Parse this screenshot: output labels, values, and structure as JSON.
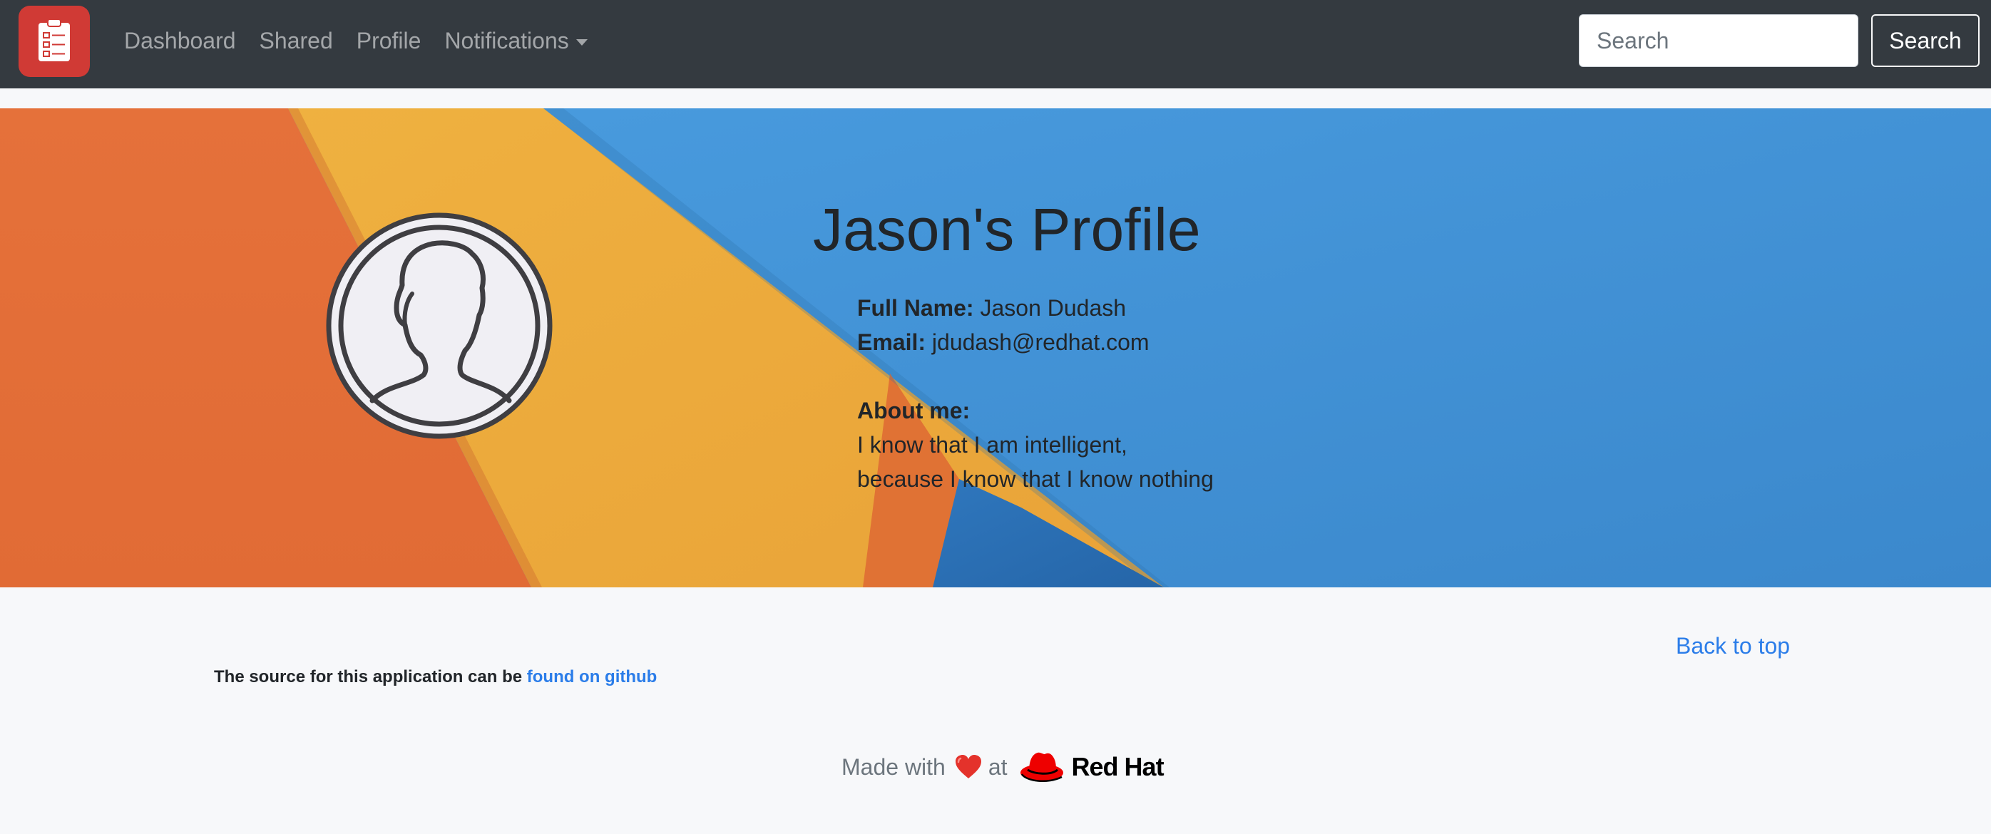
{
  "navbar": {
    "brand_icon": "clipboard-checklist-icon",
    "links": [
      {
        "label": "Dashboard"
      },
      {
        "label": "Shared"
      },
      {
        "label": "Profile"
      },
      {
        "label": "Notifications"
      }
    ],
    "search_placeholder": "Search",
    "search_button": "Search"
  },
  "profile": {
    "title": "Jason's Profile",
    "full_name_label": "Full Name:",
    "full_name": "Jason Dudash",
    "email_label": "Email:",
    "email": "jdudash@redhat.com",
    "about_label": "About me:",
    "about_line1": "I know that I am intelligent,",
    "about_line2": "because I know that I know nothing"
  },
  "footer": {
    "back_to_top": "Back to top",
    "source_text": "The source for this application can be ",
    "source_link": "found on github",
    "made_with": "Made with",
    "at": "at",
    "brand": "Red Hat"
  },
  "colors": {
    "navbar": "#343a40",
    "brand_red": "#d03a35",
    "link_blue": "#2b7de9",
    "hero_orange": "#e36f38",
    "hero_yellow": "#eda93c",
    "hero_blue": "#4396d8"
  }
}
